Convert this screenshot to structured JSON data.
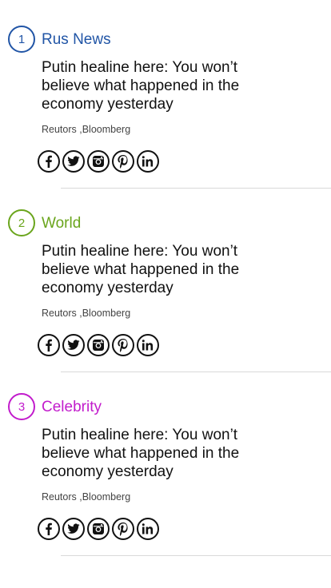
{
  "stories": [
    {
      "number": "1",
      "category": "Rus News",
      "color": "#2155a6",
      "headline": "Putin healine here: You won’t believe what happened in the economy yesterday",
      "sources": "Reutors ,Bloomberg"
    },
    {
      "number": "2",
      "category": "World",
      "color": "#6aa51c",
      "headline": "Putin healine here: You won’t believe what happened in the economy yesterday",
      "sources": "Reutors ,Bloomberg"
    },
    {
      "number": "3",
      "category": "Celebrity",
      "color": "#c21ccc",
      "headline": "Putin healine here: You won’t believe what happened in the economy yesterday",
      "sources": "Reutors ,Bloomberg"
    }
  ],
  "share_icons": [
    "facebook-icon",
    "twitter-icon",
    "instagram-icon",
    "pinterest-icon",
    "linkedin-icon"
  ]
}
